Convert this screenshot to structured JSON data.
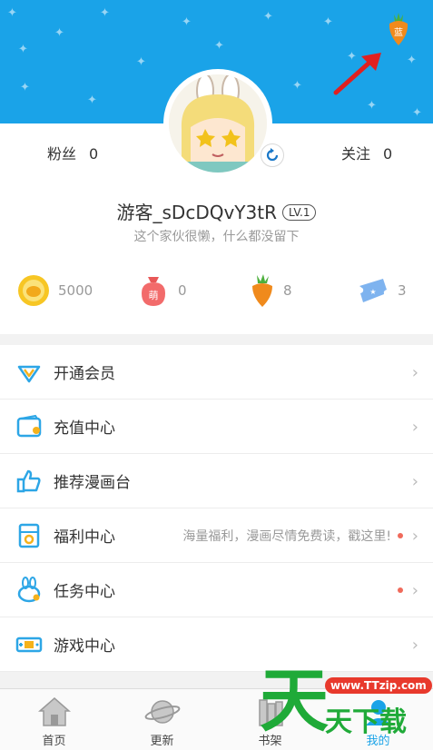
{
  "header": {
    "carrot_button_label": "蓝",
    "colors": {
      "background": "#1aa3e8",
      "accent": "#f08a1c"
    }
  },
  "profile": {
    "fans_label": "粉丝",
    "fans_count": "0",
    "follow_label": "关注",
    "follow_count": "0",
    "username": "游客_sDcDQvY3tR",
    "level": "LV.1",
    "bio": "这个家伙很懒，什么都没留下"
  },
  "wallet": [
    {
      "icon": "gold-coin-icon",
      "value": "5000"
    },
    {
      "icon": "meng-bag-icon",
      "badge": "萌",
      "value": "0"
    },
    {
      "icon": "carrot-icon",
      "value": "8"
    },
    {
      "icon": "ticket-icon",
      "value": "3"
    }
  ],
  "menu": [
    {
      "icon": "vip-diamond-icon",
      "label": "开通会员",
      "hint": "",
      "dot": false
    },
    {
      "icon": "wallet-icon",
      "label": "充值中心",
      "hint": "",
      "dot": false
    },
    {
      "icon": "thumbs-up-icon",
      "label": "推荐漫画台",
      "hint": "",
      "dot": false
    },
    {
      "icon": "gift-card-icon",
      "label": "福利中心",
      "hint": "海量福利，漫画尽情免费读，戳这里!",
      "dot": true
    },
    {
      "icon": "bunny-icon",
      "label": "任务中心",
      "hint": "",
      "dot": true
    },
    {
      "icon": "gamepad-icon",
      "label": "游戏中心",
      "hint": "",
      "dot": false
    }
  ],
  "tabbar": [
    {
      "icon": "home-icon",
      "label": "首页",
      "active": false
    },
    {
      "icon": "planet-icon",
      "label": "更新",
      "active": false
    },
    {
      "icon": "bookshelf-icon",
      "label": "书架",
      "active": false
    },
    {
      "icon": "profile-icon",
      "label": "我的",
      "active": true
    }
  ],
  "watermark": {
    "big": "天",
    "url": "www.TTzip.com",
    "small": "天下载"
  }
}
